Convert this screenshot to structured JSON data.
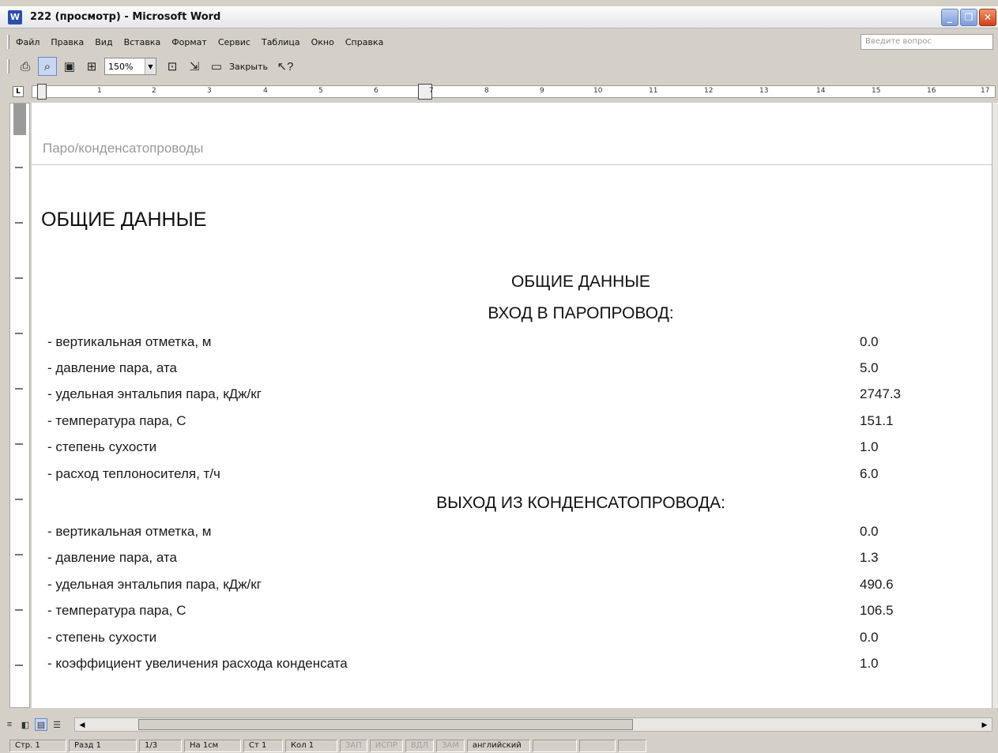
{
  "window": {
    "title": "222 (просмотр) - Microsoft Word",
    "app_icon": "W"
  },
  "menu": {
    "items": [
      "Файл",
      "Правка",
      "Вид",
      "Вставка",
      "Формат",
      "Сервис",
      "Таблица",
      "Окно",
      "Справка"
    ],
    "ask_placeholder": "Введите вопрос"
  },
  "toolbar": {
    "zoom": "150%",
    "close_label": "Закрыть"
  },
  "ruler": {
    "numbers": [
      "1",
      "2",
      "3",
      "4",
      "5",
      "6",
      "7",
      "8",
      "9",
      "10",
      "11",
      "12",
      "13",
      "14",
      "15",
      "16",
      "17"
    ]
  },
  "document": {
    "header": "Паро/конденсатопроводы",
    "title": "ОБЩИЕ ДАННЫЕ",
    "section_title": "ОБЩИЕ ДАННЫЕ",
    "inlet": {
      "heading": "ВХОД В ПАРОПРОВОД:",
      "rows": [
        {
          "label": "- вертикальная отметка, м",
          "value": "0.0"
        },
        {
          "label": "- давление пара, ата",
          "value": "5.0"
        },
        {
          "label": "- удельная энтальпия пара, кДж/кг",
          "value": "2747.3"
        },
        {
          "label": "- температура пара, С",
          "value": "151.1"
        },
        {
          "label": "- степень сухости",
          "value": "1.0"
        },
        {
          "label": "- расход теплоносителя, т/ч",
          "value": "6.0"
        }
      ]
    },
    "outlet": {
      "heading": "ВЫХОД ИЗ КОНДЕНСАТОПРОВОДА:",
      "rows": [
        {
          "label": "- вертикальная отметка, м",
          "value": "0.0"
        },
        {
          "label": "- давление пара, ата",
          "value": "1.3"
        },
        {
          "label": "- удельная энтальпия пара, кДж/кг",
          "value": "490.6"
        },
        {
          "label": "- температура пара, С",
          "value": "106.5"
        },
        {
          "label": "- степень сухости",
          "value": "0.0"
        },
        {
          "label": "- коэффициент увеличения расхода конденсата",
          "value": "1.0"
        }
      ]
    }
  },
  "status": {
    "page": "Стр. 1",
    "section": "Разд 1",
    "pages": "1/3",
    "at": "На 1см",
    "line": "Ст 1",
    "col": "Кол 1",
    "rec": "ЗАП",
    "trk": "ИСПР",
    "ext": "ВДЛ",
    "ovr": "ЗАМ",
    "lang": "английский"
  }
}
